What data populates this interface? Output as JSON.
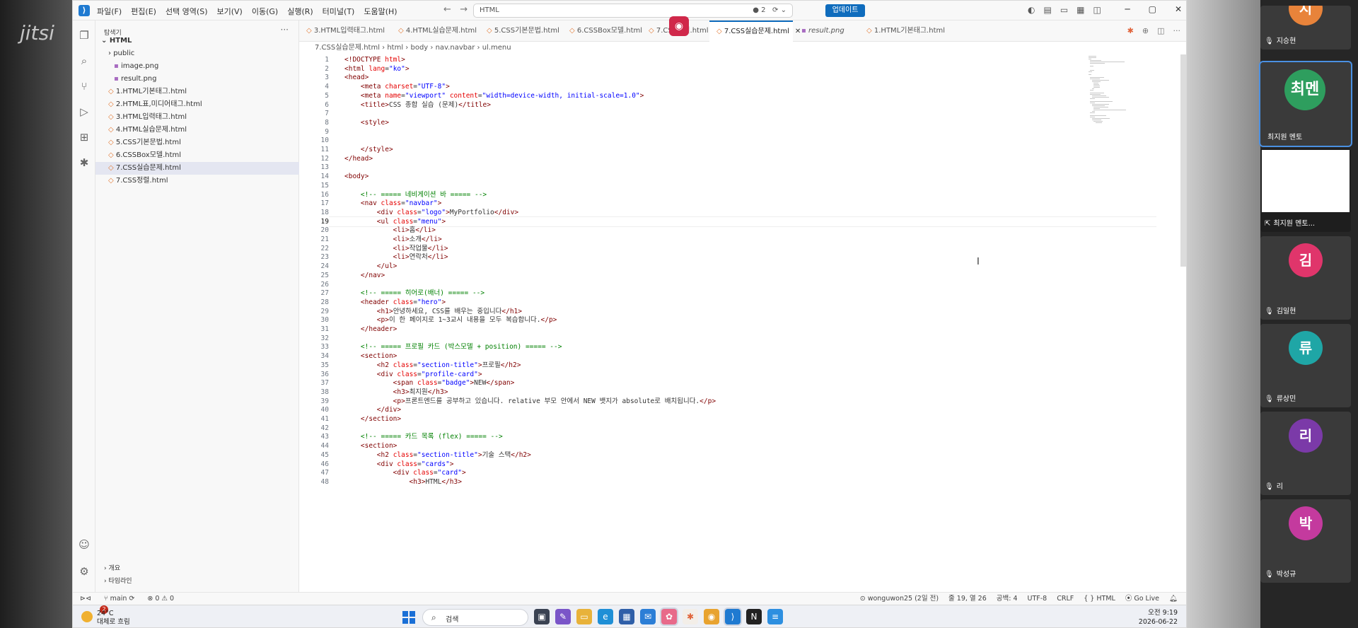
{
  "app": {
    "name": "jitsi",
    "window_search": "HTML",
    "update_label": "업데이트",
    "notification_count": "2"
  },
  "menu": [
    "파일(F)",
    "편집(E)",
    "선택 영역(S)",
    "보기(V)",
    "이동(G)",
    "실행(R)",
    "터미널(T)",
    "도움말(H)"
  ],
  "explorer": {
    "title": "탐색기",
    "root": "HTML",
    "items": [
      {
        "label": "public",
        "type": "folder"
      },
      {
        "label": "image.png",
        "type": "image"
      },
      {
        "label": "result.png",
        "type": "image"
      },
      {
        "label": "1.HTML기본태그.html",
        "type": "html"
      },
      {
        "label": "2.HTML표,미디어태그.html",
        "type": "html"
      },
      {
        "label": "3.HTML입력태그.html",
        "type": "html"
      },
      {
        "label": "4.HTML실습문제.html",
        "type": "html"
      },
      {
        "label": "5.CSS기본문법.html",
        "type": "html"
      },
      {
        "label": "6.CSSBox모델.html",
        "type": "html"
      },
      {
        "label": "7.CSS실습문제.html",
        "type": "html"
      },
      {
        "label": "7.CSS정렬.html",
        "type": "html"
      }
    ],
    "outline": "개요",
    "timeline": "타임라인"
  },
  "tabs": [
    {
      "label": "3.HTML입력태그.html"
    },
    {
      "label": "4.HTML실습문제.html"
    },
    {
      "label": "5.CSS기본문법.html"
    },
    {
      "label": "6.CSSBox모델.html"
    },
    {
      "label": "7.CSS정렬.html"
    },
    {
      "label": "7.CSS실습문제.html"
    },
    {
      "label": "result.png"
    },
    {
      "label": "1.HTML기본태그.html"
    }
  ],
  "breadcrumb": [
    "7.CSS실습문제.html",
    "html",
    "body",
    "nav.navbar",
    "ul.menu"
  ],
  "code_lines": [
    "<!DOCTYPE html>",
    "<html lang=\"ko\">",
    "<head>",
    "    <meta charset=\"UTF-8\">",
    "    <meta name=\"viewport\" content=\"width=device-width, initial-scale=1.0\">",
    "    <title>CSS 종합 실습 (문제)</title>",
    "",
    "    <style>",
    "",
    "",
    "    </style>",
    "</head>",
    "",
    "<body>",
    "",
    "    <!-- ===== 네비게이션 바 ===== -->",
    "    <nav class=\"navbar\">",
    "        <div class=\"logo\">MyPortfolio</div>",
    "        <ul class=\"menu\">",
    "            <li>홈</li>",
    "            <li>소개</li>",
    "            <li>작업물</li>",
    "            <li>연락처</li>",
    "        </ul>",
    "    </nav>",
    "",
    "    <!-- ===== 히어로(배너) ===== -->",
    "    <header class=\"hero\">",
    "        <h1>안녕하세요, CSS를 배우는 중입니다</h1>",
    "        <p>이 한 페이지로 1~3교시 내용을 모두 복습합니다.</p>",
    "    </header>",
    "",
    "    <!-- ===== 프로필 카드 (박스모델 + position) ===== -->",
    "    <section>",
    "        <h2 class=\"section-title\">프로필</h2>",
    "        <div class=\"profile-card\">",
    "            <span class=\"badge\">NEW</span>",
    "            <h3>최지원</h3>",
    "            <p>프론트엔드를 공부하고 있습니다. relative 부모 안에서 NEW 뱃지가 absolute로 배치됩니다.</p>",
    "        </div>",
    "    </section>",
    "",
    "    <!-- ===== 카드 목록 (flex) ===== -->",
    "    <section>",
    "        <h2 class=\"section-title\">기술 스택</h2>",
    "        <div class=\"cards\">",
    "            <div class=\"card\">",
    "                <h3>HTML</h3>"
  ],
  "status": {
    "branch": "main",
    "problems": "⊗ 0  ⚠ 0",
    "author": "wonguwon25 (2일 전)",
    "position": "줄 19, 열 26",
    "spaces": "공백: 4",
    "encoding": "UTF-8",
    "eol": "CRLF",
    "language": "HTML",
    "golive": "Go Live"
  },
  "taskbar": {
    "temp": "24°C",
    "weather": "대체로 흐림",
    "weather_badge": "2",
    "search": "검색",
    "time": "오전 9:19",
    "date": "2026-06-22"
  },
  "participants": [
    {
      "initial": "지",
      "name": "지승현",
      "color": "#e8833a"
    },
    {
      "initial": "최멘",
      "name": "최지원 멘토",
      "color": "#2e9e5e"
    },
    {
      "initial": "",
      "name": "최지원 멘토...",
      "color": "#ffffff"
    },
    {
      "initial": "김",
      "name": "김일현",
      "color": "#e0356b"
    },
    {
      "initial": "류",
      "name": "류상민",
      "color": "#1fa6a6"
    },
    {
      "initial": "리",
      "name": "리",
      "color": "#7b3aa8"
    },
    {
      "initial": "박",
      "name": "박성규",
      "color": "#c43a9e"
    }
  ]
}
